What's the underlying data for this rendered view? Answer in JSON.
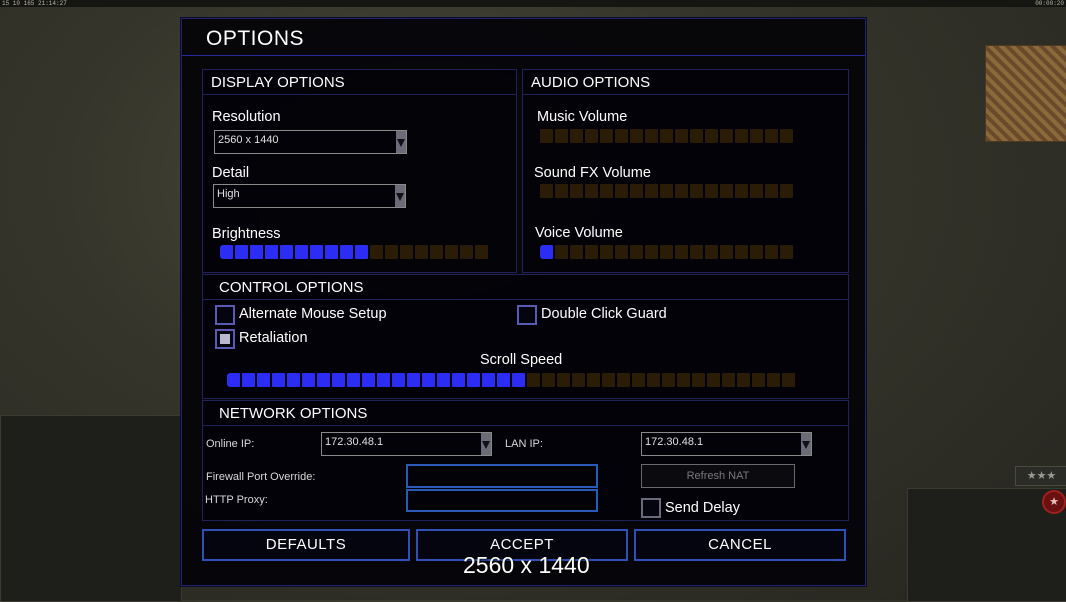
{
  "hud": {
    "top_left_text": "15 10 165 21:14:27",
    "top_right_text": "00:00:20",
    "stars": "★★★"
  },
  "dialog": {
    "title": "OPTIONS",
    "display": {
      "heading": "DISPLAY OPTIONS",
      "resolution_label": "Resolution",
      "resolution_value": "2560 x 1440",
      "detail_label": "Detail",
      "detail_value": "High",
      "brightness_label": "Brightness",
      "brightness_level": 10,
      "brightness_max": 18
    },
    "audio": {
      "heading": "AUDIO OPTIONS",
      "music_label": "Music Volume",
      "music_level": 0,
      "sfx_label": "Sound FX Volume",
      "sfx_level": 0,
      "voice_label": "Voice Volume",
      "voice_level": 1,
      "max": 17
    },
    "control": {
      "heading": "CONTROL OPTIONS",
      "alt_mouse_label": "Alternate Mouse Setup",
      "alt_mouse_checked": false,
      "double_click_label": "Double Click Guard",
      "double_click_checked": false,
      "retaliation_label": "Retaliation",
      "retaliation_checked": true,
      "scroll_label": "Scroll Speed",
      "scroll_level": 20,
      "scroll_max": 38
    },
    "network": {
      "heading": "NETWORK OPTIONS",
      "online_ip_label": "Online IP:",
      "online_ip_value": "172.30.48.1",
      "lan_ip_label": "LAN IP:",
      "lan_ip_value": "172.30.48.1",
      "firewall_label": "Firewall Port Override:",
      "firewall_value": "",
      "proxy_label": "HTTP Proxy:",
      "proxy_value": "",
      "refresh_nat_label": "Refresh NAT",
      "send_delay_label": "Send Delay",
      "send_delay_checked": false
    },
    "buttons": {
      "defaults": "DEFAULTS",
      "accept": "ACCEPT",
      "cancel": "CANCEL"
    },
    "overlay_resolution": "2560 x 1440"
  },
  "colors": {
    "slider_on": "#2c2cf4",
    "slider_off": "#2a1c06",
    "frame_blue": "#3050b8"
  }
}
